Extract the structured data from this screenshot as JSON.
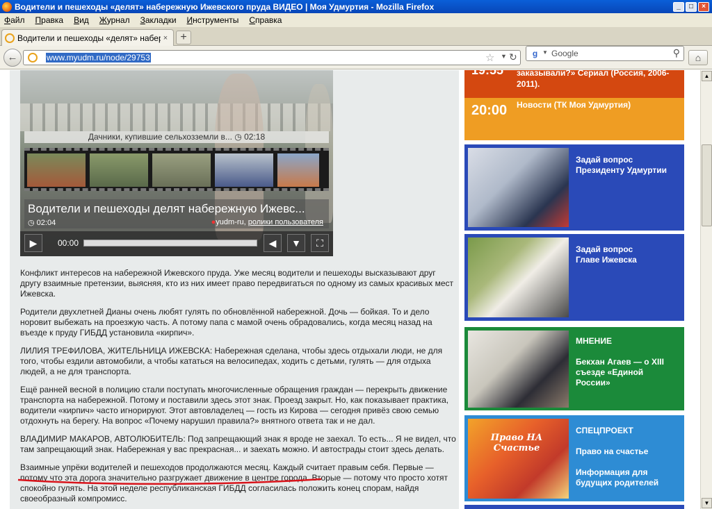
{
  "window": {
    "title": "Водители и пешеходы «делят» набережную Ижевского пруда ВИДЕО | Моя Удмуртия - Mozilla Firefox",
    "minimize": "_",
    "maximize": "□",
    "close": "×"
  },
  "menu": [
    "Файл",
    "Правка",
    "Вид",
    "Журнал",
    "Закладки",
    "Инструменты",
    "Справка"
  ],
  "tab": {
    "label": "Водители и пешеходы «делят» набереж...",
    "close": "×",
    "new_tab": "+"
  },
  "nav": {
    "back": "←",
    "url": "www.myudm.ru/node/29753",
    "star": "☆",
    "dropdown": "▼",
    "reload": "↻",
    "search_engine_icon": "g",
    "search_dropdown": "▼",
    "search_placeholder": "Google",
    "search_icon": "⚲",
    "home": "⌂"
  },
  "player": {
    "related_title": "Дачники, купившие сельхозземли в...",
    "related_clock": "◷",
    "related_duration": "02:18",
    "title": "Водители и пешеходы делят набережную Ижевс...",
    "clock": "◷",
    "duration": "02:04",
    "source_dot": "●",
    "source": "yudm-ru,",
    "source_link": "ролики пользователя",
    "play": "▶",
    "time": "00:00",
    "volume": "◀",
    "menu": "▼",
    "fullscreen": "⛶"
  },
  "article": {
    "p1": "Конфликт интересов на набережной Ижевского пруда. Уже месяц водители и пешеходы высказывают друг другу взаимные претензии, выясняя, кто из них имеет право передвигаться по одному из самых красивых мест Ижевска.",
    "p2": "Родители двухлетней Дианы очень любят гулять по обновлённой набережной. Дочь — бойкая. То и дело норовит выбежать на проезжую часть. А потому папа с мамой очень обрадовались, когда месяц назад на въезде к пруду ГИБДД установила «кирпич».",
    "p3": "ЛИЛИЯ ТРЕФИЛОВА, ЖИТЕЛЬНИЦА ИЖЕВСКА: Набережная сделана, чтобы здесь отдыхали люди, не для того, чтобы ездили автомобили, а чтобы кататься на велосипедах, ходить с детьми, гулять — для отдыха людей, а не для транспорта.",
    "p4": "Ещё ранней весной в полицию стали поступать многочисленные обращения граждан — перекрыть движение транспорта на набережной. Потому и поставили здесь этот знак. Проезд закрыт. Но, как показывает практика, водители «кирпич» часто игнорируют. Этот автовладелец — гость из Кирова — сегодня привёз свою семью отдохнуть на берегу. На вопрос «Почему нарушил правила?» внятного ответа так и не дал.",
    "p5": "ВЛАДИМИР МАКАРОВ, АВТОЛЮБИТЕЛЬ: Под запрещающий знак я вроде не заехал. То есть... Я не видел, что там запрещающий знак. Набережная у вас прекрасная... и заехать можно. И автострады стоит здесь делать.",
    "p6": "Взаимные упрёки водителей и пешеходов продолжаются месяц. Каждый считает правым себя. Первые — потому что эта дорога значительно разгружает движение в центре города. Вторые — потому что просто хотят спокойно гулять. На этой неделе республиканская ГИБДД согласилась положить конец спорам, найдя своеобразный компромисс."
  },
  "sidebar": {
    "tv_prev_title": "заказывали?» Сериал (Россия, 2006-2011).",
    "tv_prev_time": "19:55",
    "tv_next_time": "20:00",
    "tv_next_title": "Новости (ТК Моя Удмуртия)",
    "promo1": "Задай вопрос Президенту Удмуртии",
    "promo2_line1": "Задай вопрос",
    "promo2_line2": "Главе Ижевска",
    "promo3_head": "МНЕНИЕ",
    "promo3_text": "Бекхан Агаев — о XIII съезде «Единой России»",
    "promo4_head": "СПЕЦПРОЕКТ",
    "promo4_line1": "Право на счастье",
    "promo4_line2": "Информация для будущих родителей",
    "promo4_img_text": "Право НА Счастье"
  },
  "scrollbar": {
    "up": "▲",
    "down": "▼"
  }
}
